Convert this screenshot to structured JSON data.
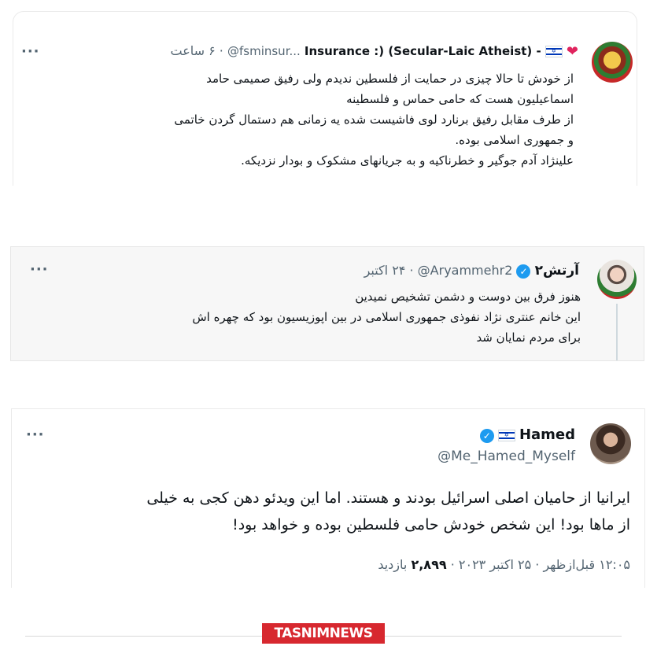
{
  "tweet1": {
    "display_name": "Insurance :) (Secular-Laic Atheist) -",
    "handle": "@fsminsur...",
    "time": "۶ ساعت",
    "lines": [
      "از خودش تا حالا چیزی در حمایت از فلسطین ندیدم ولی رفیق صمیمی حامد",
      "اسماعیلیون هست که حامی حماس و فلسطینه",
      "از طرف مقابل رفیق برنارد لوی فاشیست شده یه زمانی هم دستمال گردن خاتمی",
      "و جمهوری اسلامی بوده.",
      "علینژاد آدم جوگیر و خطرناکیه و به جریانهای مشکوک و بودار نزدیکه."
    ]
  },
  "tweet2": {
    "display_name": "آرتش۲",
    "handle": "@Aryammehr2",
    "time": "۲۴ اکتبر",
    "lines": [
      "هنوز فرق بین دوست و دشمن تشخیص نمیدین",
      "این خانم عنتری نژاد نفوذی جمهوری اسلامی در بین اپوزیسیون بود که چهره اش",
      "برای مردم نمایان شد"
    ]
  },
  "tweet3": {
    "display_name": "Hamed",
    "handle": "@Me_Hamed_Myself",
    "lines": [
      "ایرانیا از حامیان اصلی اسرائیل بودند و هستند. اما این ویدئو دهن کجی به خیلی",
      "از ماها بود! این شخص خودش حامی فلسطین بوده و خواهد بود!"
    ],
    "time": "۱۲:۰۵ قبل‌ازظهر",
    "date": "۲۵ اکتبر ۲۰۲۳",
    "views_count": "۲,۸۹۹",
    "views_label": "بازدید"
  },
  "watermark": "TASNIMNEWS",
  "icons": {
    "more": "more-dots-icon",
    "verified": "verified-badge-icon",
    "flag": "israel-flag-icon",
    "heart": "heart-icon"
  },
  "colors": {
    "verified": "#1d9bf0",
    "watermark_bg": "#d7282f",
    "secondary_text": "#536471"
  }
}
